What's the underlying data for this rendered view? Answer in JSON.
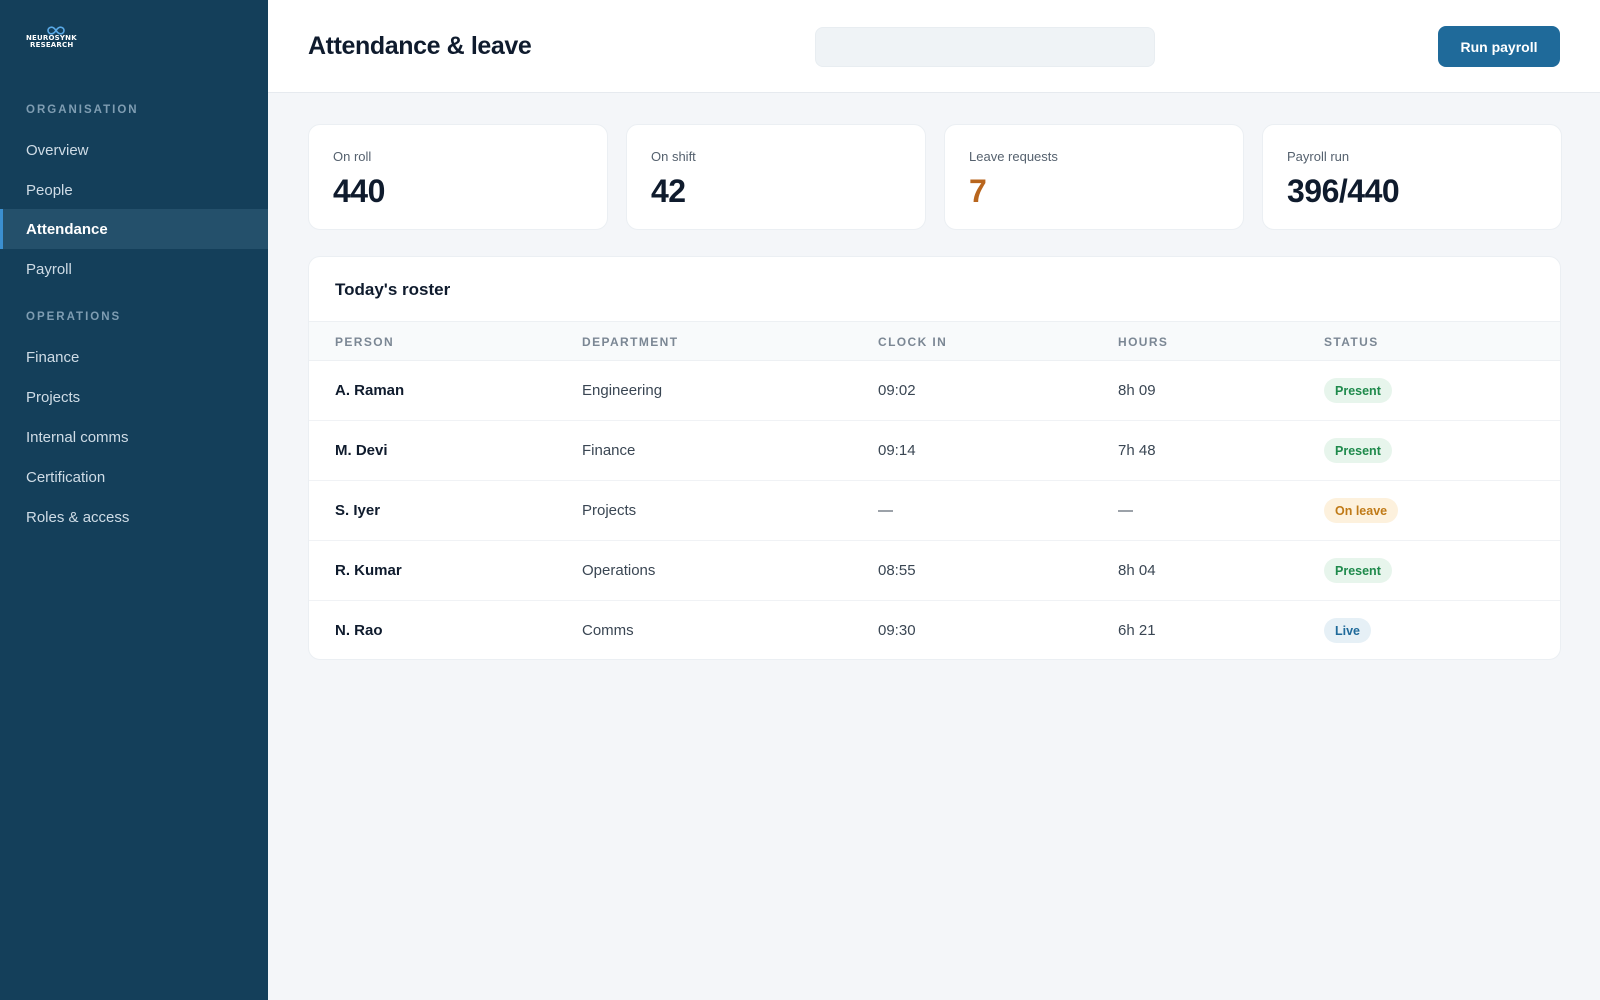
{
  "brand": {
    "line1": "NEUROSYNK",
    "line2": "RESEARCH"
  },
  "sidebar": {
    "sections": [
      {
        "label": "ORGANISATION",
        "items": [
          {
            "label": "Overview",
            "active": false
          },
          {
            "label": "People",
            "active": false
          },
          {
            "label": "Attendance",
            "active": true
          },
          {
            "label": "Payroll",
            "active": false
          }
        ]
      },
      {
        "label": "OPERATIONS",
        "items": [
          {
            "label": "Finance",
            "active": false
          },
          {
            "label": "Projects",
            "active": false
          },
          {
            "label": "Internal comms",
            "active": false
          },
          {
            "label": "Certification",
            "active": false
          },
          {
            "label": "Roles & access",
            "active": false
          }
        ]
      }
    ]
  },
  "header": {
    "title": "Attendance & leave",
    "search_value": "",
    "primary_action": "Run payroll"
  },
  "stats": [
    {
      "label": "On roll",
      "value": "440"
    },
    {
      "label": "On shift",
      "value": "42"
    },
    {
      "label": "Leave requests",
      "value": "7",
      "highlight": "#b8651d"
    },
    {
      "label": "Payroll run",
      "value": "396/440"
    }
  ],
  "roster": {
    "title": "Today's roster",
    "columns": [
      "PERSON",
      "DEPARTMENT",
      "CLOCK IN",
      "HOURS",
      "STATUS"
    ],
    "rows": [
      {
        "person": "A. Raman",
        "department": "Engineering",
        "clock_in": "09:02",
        "hours": "8h 09",
        "status": "Present"
      },
      {
        "person": "M. Devi",
        "department": "Finance",
        "clock_in": "09:14",
        "hours": "7h 48",
        "status": "Present"
      },
      {
        "person": "S. Iyer",
        "department": "Projects",
        "clock_in": "—",
        "hours": "—",
        "status": "On leave"
      },
      {
        "person": "R. Kumar",
        "department": "Operations",
        "clock_in": "08:55",
        "hours": "8h 04",
        "status": "Present"
      },
      {
        "person": "N. Rao",
        "department": "Comms",
        "clock_in": "09:30",
        "hours": "6h 21",
        "status": "Live"
      }
    ]
  },
  "colors": {
    "sidebar_bg": "#143f5a",
    "accent": "#1f6a9a",
    "present": "#1f8a4c",
    "leave": "#c07a17",
    "live": "#1f6a9a"
  }
}
